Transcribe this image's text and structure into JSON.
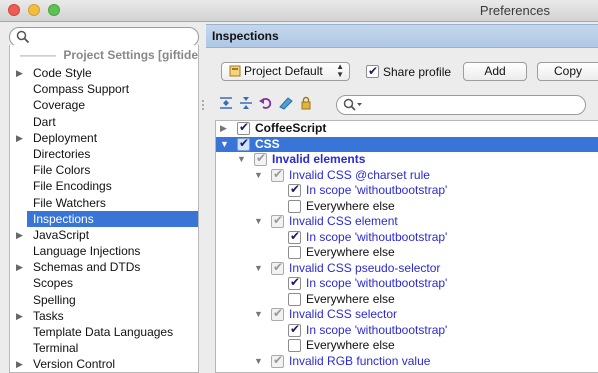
{
  "window": {
    "title": "Preferences"
  },
  "sidebar": {
    "search_placeholder": "",
    "header": "Project Settings [giftidea]",
    "items": [
      {
        "label": "Code Style",
        "expandable": true
      },
      {
        "label": "Compass Support",
        "expandable": false
      },
      {
        "label": "Coverage",
        "expandable": false
      },
      {
        "label": "Dart",
        "expandable": false
      },
      {
        "label": "Deployment",
        "expandable": true
      },
      {
        "label": "Directories",
        "expandable": false
      },
      {
        "label": "File Colors",
        "expandable": false
      },
      {
        "label": "File Encodings",
        "expandable": false
      },
      {
        "label": "File Watchers",
        "expandable": false
      },
      {
        "label": "Inspections",
        "expandable": false,
        "selected": true
      },
      {
        "label": "JavaScript",
        "expandable": true
      },
      {
        "label": "Language Injections",
        "expandable": false
      },
      {
        "label": "Schemas and DTDs",
        "expandable": true
      },
      {
        "label": "Scopes",
        "expandable": false
      },
      {
        "label": "Spelling",
        "expandable": false
      },
      {
        "label": "Tasks",
        "expandable": true
      },
      {
        "label": "Template Data Languages",
        "expandable": false
      },
      {
        "label": "Terminal",
        "expandable": false
      },
      {
        "label": "Version Control",
        "expandable": true
      }
    ]
  },
  "main": {
    "section_title": "Inspections",
    "profile_select": {
      "value": "Project Default"
    },
    "share_profile": {
      "label": "Share profile",
      "checked": true
    },
    "add_button": "Add",
    "copy_button": "Copy",
    "toolbar_icons": [
      "expand-all-icon",
      "collapse-all-icon",
      "reset-icon",
      "edit-icon",
      "lock-icon"
    ],
    "filter_placeholder": "",
    "tree": [
      {
        "label": "CoffeeScript",
        "level": 0,
        "arrow": "right",
        "checked": true,
        "style": "bold"
      },
      {
        "label": "CSS",
        "level": 0,
        "arrow": "down",
        "checked": true,
        "style": "bold",
        "selected": true
      },
      {
        "label": "Invalid elements",
        "level": 1,
        "arrow": "down",
        "checked": true,
        "style": "bold-blue"
      },
      {
        "label": "Invalid CSS @charset rule",
        "level": 2,
        "arrow": "down",
        "checked": true,
        "style": "blue"
      },
      {
        "label": "In scope 'withoutbootstrap'",
        "level": 3,
        "checked": true,
        "style": "blue"
      },
      {
        "label": "Everywhere else",
        "level": 3,
        "checked": false,
        "style": "black"
      },
      {
        "label": "Invalid CSS element",
        "level": 2,
        "arrow": "down",
        "checked": true,
        "style": "blue"
      },
      {
        "label": "In scope 'withoutbootstrap'",
        "level": 3,
        "checked": true,
        "style": "blue"
      },
      {
        "label": "Everywhere else",
        "level": 3,
        "checked": false,
        "style": "black"
      },
      {
        "label": "Invalid CSS pseudo-selector",
        "level": 2,
        "arrow": "down",
        "checked": true,
        "style": "blue"
      },
      {
        "label": "In scope 'withoutbootstrap'",
        "level": 3,
        "checked": true,
        "style": "blue"
      },
      {
        "label": "Everywhere else",
        "level": 3,
        "checked": false,
        "style": "black"
      },
      {
        "label": "Invalid CSS selector",
        "level": 2,
        "arrow": "down",
        "checked": true,
        "style": "blue"
      },
      {
        "label": "In scope 'withoutbootstrap'",
        "level": 3,
        "checked": true,
        "style": "blue"
      },
      {
        "label": "Everywhere else",
        "level": 3,
        "checked": false,
        "style": "black"
      },
      {
        "label": "Invalid RGB function value",
        "level": 2,
        "arrow": "down",
        "checked": true,
        "style": "blue"
      }
    ]
  },
  "colors": {
    "selection": "#3875d7",
    "section_header": "#c4d6ec",
    "link_blue": "#2a2ad8"
  }
}
